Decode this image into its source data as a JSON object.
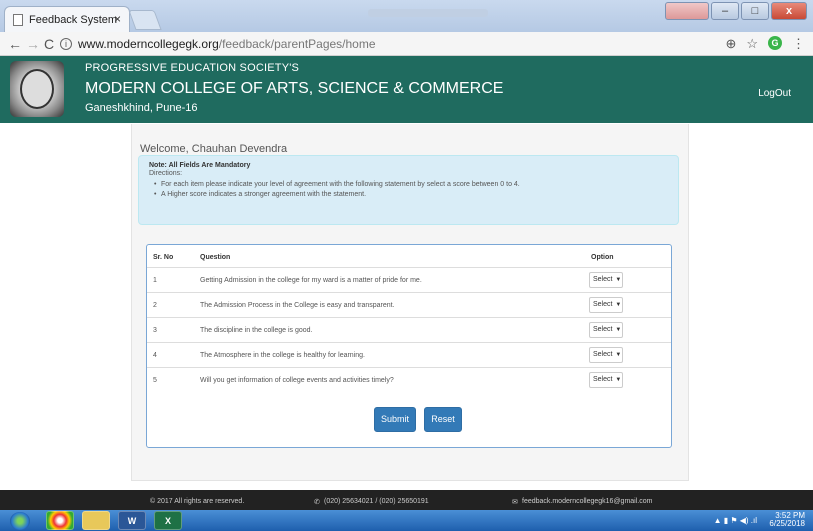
{
  "browser": {
    "tab_title": "Feedback System",
    "tab_close": "×",
    "url_host": "www.moderncollegegk.org",
    "url_path": "/feedback/parentPages/home",
    "win_minimize": "–",
    "win_maximize": "□",
    "win_close": "x"
  },
  "header": {
    "society": "PROGRESSIVE EDUCATION SOCIETY'S",
    "college": "MODERN COLLEGE OF ARTS, SCIENCE & COMMERCE",
    "address": "Ganeshkhind, Pune-16",
    "logout": "LogOut"
  },
  "main": {
    "welcome": "Welcome, Chauhan Devendra",
    "note_title": "Note: All Fields Are Mandatory",
    "directions": "Directions:",
    "bullets": [
      "For each item please indicate your level of agreement with the following statement by select a score between 0 to 4.",
      "A Higher score indicates a stronger agreement with the statement."
    ],
    "table_headers": {
      "sr": "Sr. No",
      "question": "Question",
      "option": "Option"
    },
    "questions": [
      {
        "sr": "1",
        "text": "Getting Admission in the college for my ward is a matter of pride for me.",
        "option": "Select"
      },
      {
        "sr": "2",
        "text": "The Admission Process in the College is easy and transparent.",
        "option": "Select"
      },
      {
        "sr": "3",
        "text": "The discipline in the college is good.",
        "option": "Select"
      },
      {
        "sr": "4",
        "text": "The Atmosphere in the college is healthy for learning.",
        "option": "Select"
      },
      {
        "sr": "5",
        "text": "Will you get information of college events and activities timely?",
        "option": "Select"
      }
    ],
    "submit_label": "Submit",
    "reset_label": "Reset"
  },
  "footer": {
    "copyright": "© 2017 All rights are reserved.",
    "phone": "(020) 25634021 / (020) 25650191",
    "email": "feedback.moderncollegegk16@gmail.com"
  },
  "taskbar": {
    "time": "3:52 PM",
    "date": "6/25/2018",
    "word_label": "W",
    "excel_label": "X"
  },
  "colors": {
    "header_bg": "#1f6b5f",
    "note_bg": "#d9edf7",
    "button_primary": "#337ab7",
    "footer_bg": "#222222"
  }
}
